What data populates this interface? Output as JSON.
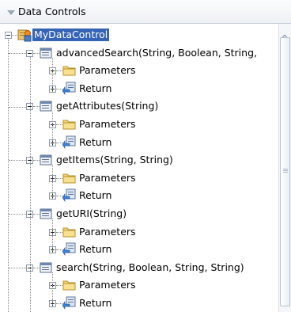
{
  "panel": {
    "title": "Data Controls"
  },
  "root": {
    "label": "MyDataControl"
  },
  "methods": [
    {
      "label": "advancedSearch(String, Boolean, String,",
      "children": [
        "Parameters",
        "Return"
      ]
    },
    {
      "label": "getAttributes(String)",
      "children": [
        "Parameters",
        "Return"
      ]
    },
    {
      "label": "getItems(String, String)",
      "children": [
        "Parameters",
        "Return"
      ]
    },
    {
      "label": "getURI(String)",
      "children": [
        "Parameters",
        "Return"
      ]
    },
    {
      "label": "search(String, Boolean, String, String)",
      "children": [
        "Parameters",
        "Return"
      ]
    }
  ],
  "icons": {
    "root": "data-control-icon",
    "method": "method-icon",
    "parameters": "folder-icon",
    "return": "return-icon"
  },
  "colors": {
    "selection": "#3563b5",
    "folder": "#f5d679"
  }
}
